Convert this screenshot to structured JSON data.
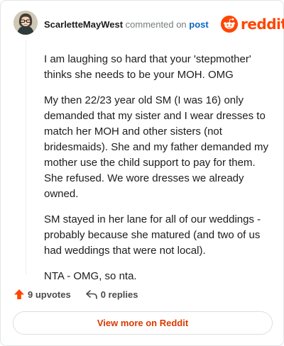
{
  "header": {
    "username": "ScarletteMayWest",
    "action_text": "commented on",
    "post_link": "post",
    "brand_name": "reddit"
  },
  "comment": {
    "paragraphs": [
      "I am laughing so hard that your 'stepmother' thinks she needs to be your MOH. OMG",
      "My then 22/23 year old SM (I was 16) only demanded that my sister and I wear dresses to match her MOH and other sisters (not bridesmaids). She and my father demanded my mother use the child support to pay for them. She refused. We wore dresses we already owned.",
      "SM stayed in her lane for all of our weddings - probably because she matured (and two of us had weddings that were not local).",
      "NTA - OMG, so nta."
    ]
  },
  "actions": {
    "upvotes_label": "9 upvotes",
    "replies_label": "0 replies"
  },
  "footer": {
    "view_more_label": "View more on Reddit"
  },
  "colors": {
    "brand": "#ff4500",
    "link": "#0a66c2",
    "view_more": "#d93a00",
    "upvote_arrow": "#ff4500"
  },
  "icons": {
    "avatar": "avatar-icon",
    "brand_logo": "reddit-logo-icon",
    "upvote": "upvote-arrow-icon",
    "reply": "reply-arrow-icon"
  }
}
